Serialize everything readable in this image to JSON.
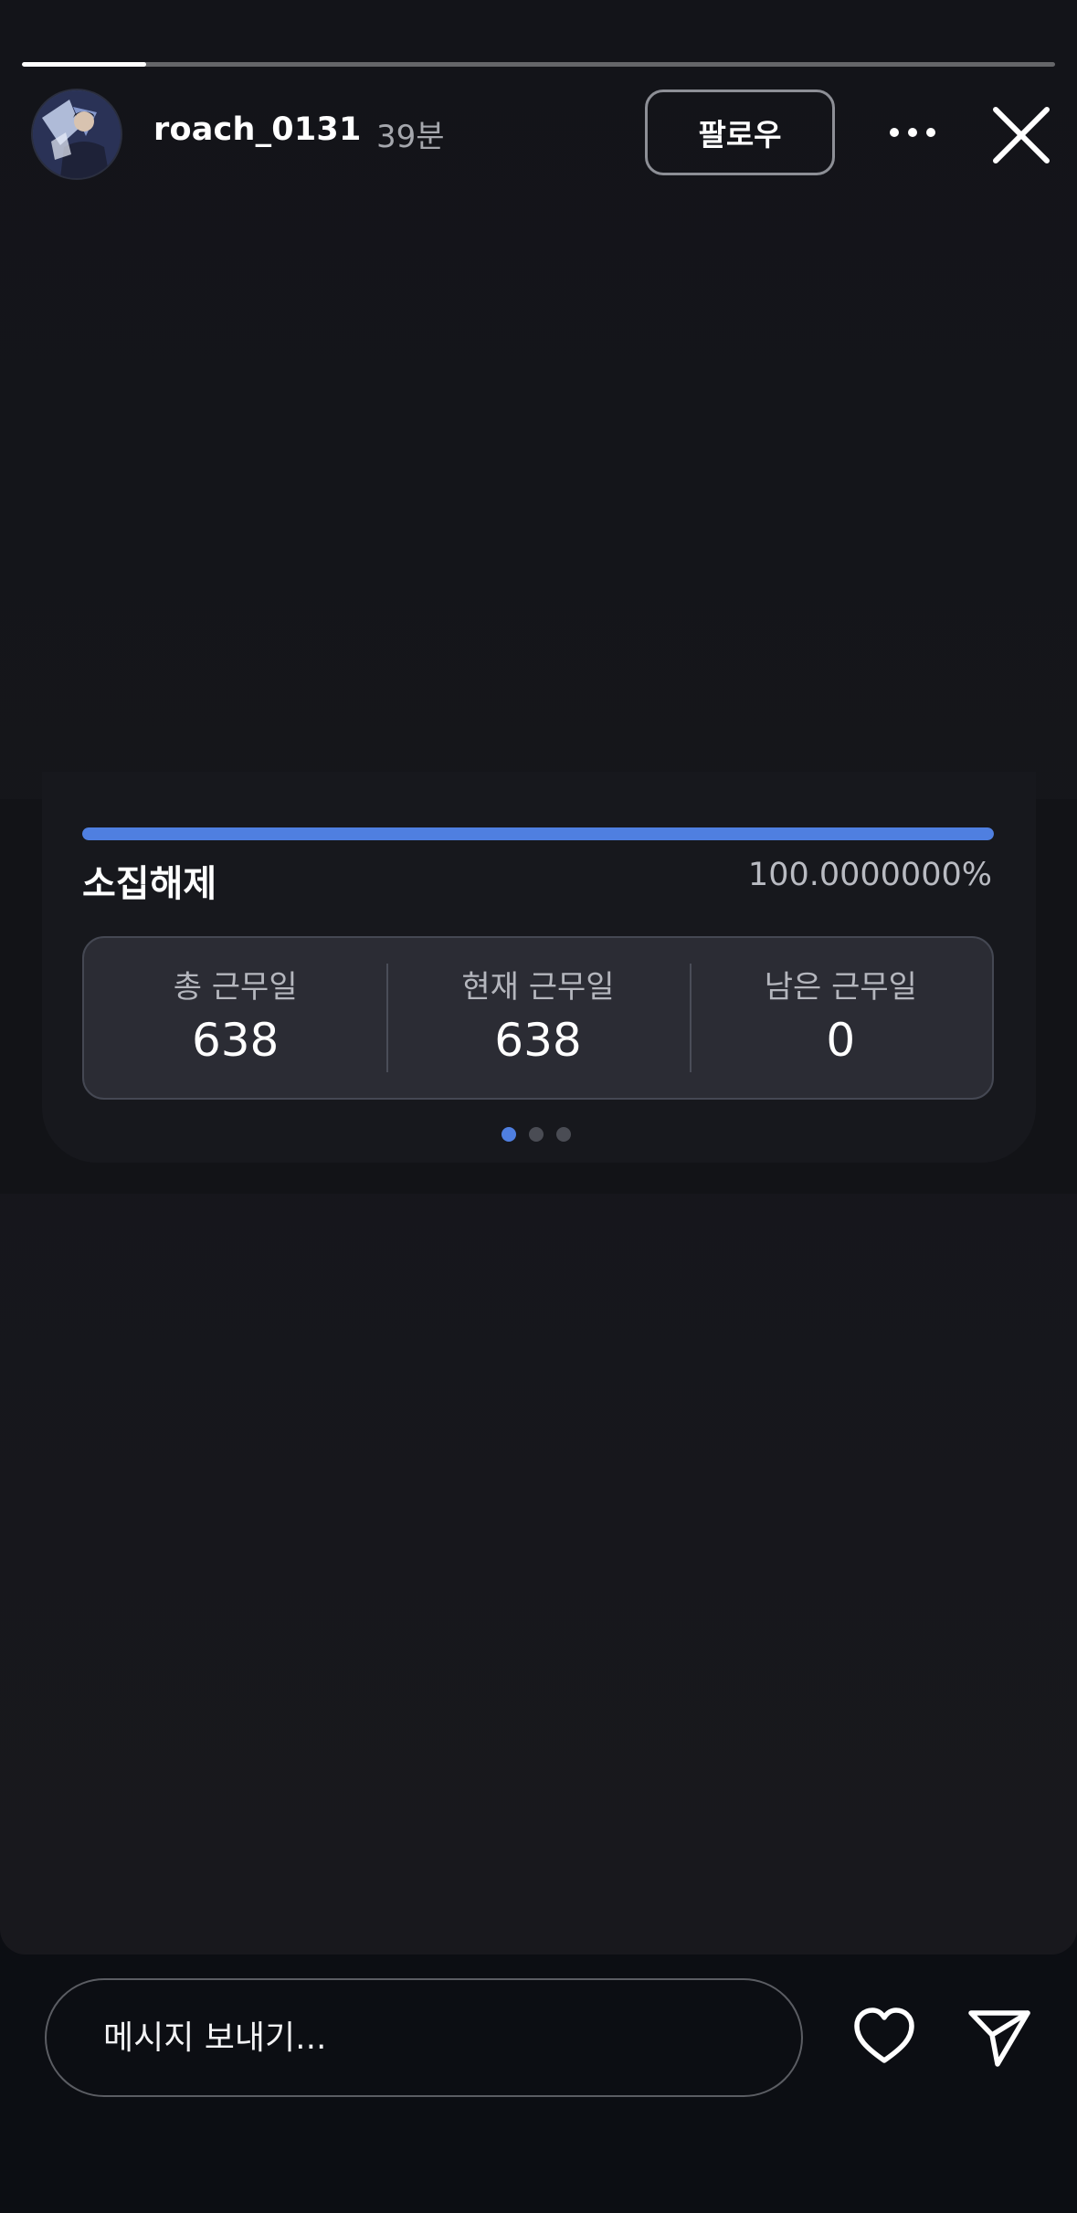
{
  "header": {
    "username": "roach_0131",
    "time_ago": "39분",
    "follow_label": "팔로우",
    "progress": 0.12
  },
  "card": {
    "status_label": "소집해제",
    "percent_text": "100.0000000%",
    "progress": 1.0,
    "stats": [
      {
        "label": "총 근무일",
        "value": "638"
      },
      {
        "label": "현재 근무일",
        "value": "638"
      },
      {
        "label": "남은 근무일",
        "value": "0"
      }
    ],
    "pages": {
      "count": 3,
      "active": 0
    }
  },
  "footer": {
    "message_placeholder": "메시지 보내기..."
  },
  "icons": {
    "more": "more-horizontal-icon",
    "close": "close-icon",
    "like": "heart-icon",
    "send": "send-icon"
  },
  "colors": {
    "accent": "#4f7fe0",
    "background": "#0c0e13"
  }
}
